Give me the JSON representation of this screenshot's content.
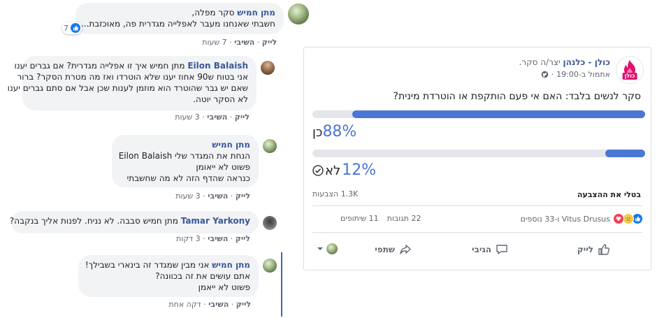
{
  "comments": [
    {
      "name": "מתן חמיש",
      "lines": [
        "סקר מפלה,",
        "חשבתי שאנחנו מעבר לאפלייה מגדרית פה, מאוכזבת..."
      ],
      "reaction_count": "7",
      "like": "לייק",
      "reply": "השיבי",
      "time": "7 שעות"
    },
    {
      "name": "Eilon Balaish",
      "lines": [
        "מתן חמיש איך זו אפלייה מגדרית? אם גברים יענו",
        "אני בטוח ש90 אחוז יענו שלא הוטרדו ואז מה מטרת הסקר? ברור",
        "שאם יש גבר שהוטרד הוא מוזמן לענות שכן אבל אם סתם גברים יענו",
        "לא הסקר יוטה."
      ],
      "like": "לייק",
      "reply": "השיבי",
      "time": "3 שעות"
    },
    {
      "name": "מתן חמיש",
      "lines": [
        "הנחת את המגדר שלי Eilon Balaish",
        "פשוט לא ייאומן",
        "כנראה שהדף הזה לא מה שחשבתי"
      ],
      "like": "לייק",
      "reply": "השיבי",
      "time": "3 שעות"
    },
    {
      "name": "Tamar Yarkony",
      "lines": [
        "מתן חמיש סבבה. לא נניח. לפנות אליך בנקבה?"
      ],
      "like": "לייק",
      "reply": "השיבי",
      "time": "3 דקות"
    },
    {
      "name": "מתן חמיש",
      "lines": [
        "אני מבין שמגדר זה בינארי בשבילך!",
        "אתם עושים את זה בכוונה?",
        "פשוט לא ייאמן"
      ],
      "like": "לייק",
      "reply": "השיבי",
      "time": "דקה אחת"
    }
  ],
  "post": {
    "page_name": "כולן - כלנהן",
    "created_text": "יצר/ה סקר.",
    "timestamp": "אתמול ב-19:00",
    "logo_text": "כולן",
    "question": "סקר לנשים בלבד: האם אי פעם הותקפת או הוטרדת מינית?",
    "options": [
      {
        "label": "כן",
        "percent": "88%",
        "fill": 0.88
      },
      {
        "label": "לא",
        "percent": "12%",
        "fill": 0.12
      }
    ],
    "votes_count": "1.3K הצבעות",
    "cancel_vote": "בטלי את ההצבעה",
    "reactions_text": "Vitus Drusus ו-33 נוספים",
    "comments_count": "22 תגובות",
    "shares_count": "11 שיתופים",
    "actions": {
      "like": "לייק",
      "comment": "הגיבי",
      "share": "שתפי"
    }
  },
  "colors": {
    "accent": "#4a76d6",
    "link": "#385898",
    "brand": "#e0116f"
  }
}
